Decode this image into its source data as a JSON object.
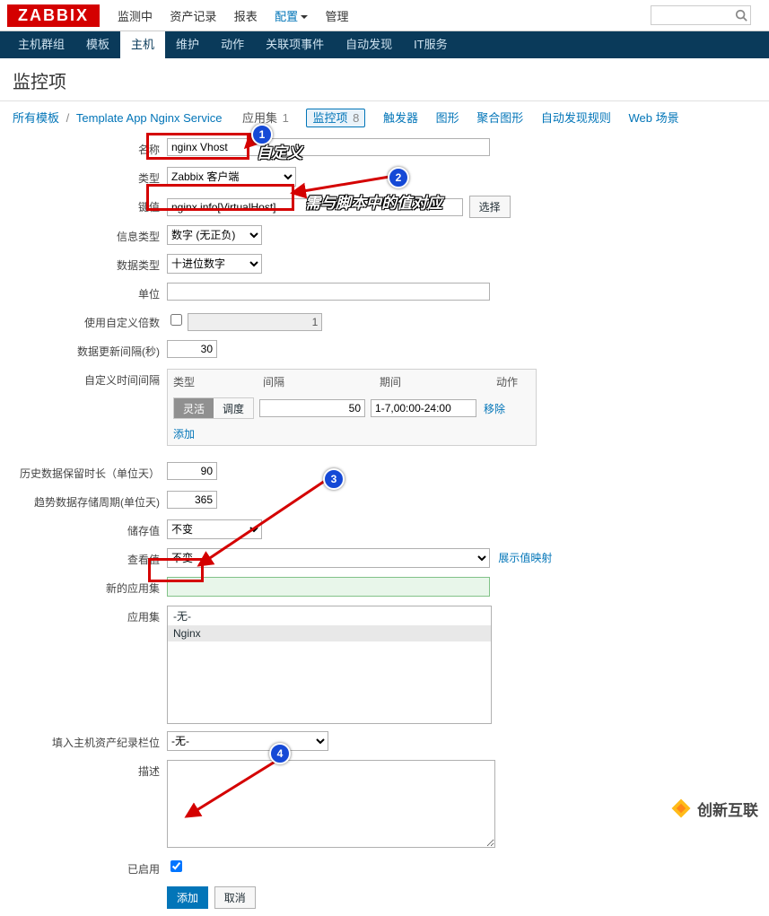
{
  "brand": "ZABBIX",
  "topnav": {
    "items": [
      "监测中",
      "资产记录",
      "报表",
      "配置",
      "管理"
    ],
    "active_idx": 3
  },
  "subnav": {
    "items": [
      "主机群组",
      "模板",
      "主机",
      "维护",
      "动作",
      "关联项事件",
      "自动发现",
      "IT服务"
    ],
    "active_idx": 2
  },
  "page_title": "监控项",
  "crumbs": {
    "root": "所有模板",
    "template": "Template App Nginx Service",
    "tabs": [
      {
        "label": "应用集",
        "count": "1"
      },
      {
        "label": "监控项",
        "count": "8",
        "current": true
      },
      {
        "label": "触发器",
        "count": ""
      },
      {
        "label": "图形",
        "count": ""
      },
      {
        "label": "聚合图形",
        "count": ""
      },
      {
        "label": "自动发现规则",
        "count": ""
      },
      {
        "label": "Web 场景",
        "count": ""
      }
    ]
  },
  "form": {
    "labels": {
      "name": "名称",
      "type": "类型",
      "key": "键值",
      "info_type": "信息类型",
      "data_type": "数据类型",
      "unit": "单位",
      "use_mult": "使用自定义倍数",
      "update": "数据更新间隔(秒)",
      "custom_int": "自定义时间间隔",
      "history": "历史数据保留时长（单位天）",
      "trend": "趋势数据存储周期(单位天)",
      "store": "储存值",
      "viewval": "查看值",
      "newapp": "新的应用集",
      "apps": "应用集",
      "inventory": "填入主机资产纪录栏位",
      "desc": "描述",
      "enabled": "已启用"
    },
    "name": "nginx Vhost",
    "type": "Zabbix 客户端",
    "key": "nginx.info[VirtualHost]",
    "select_btn": "选择",
    "info_type": "数字 (无正负)",
    "data_type": "十进位数字",
    "unit": "",
    "use_mult": false,
    "mult_val": "1",
    "update": "30",
    "interval": {
      "head": {
        "type": "类型",
        "interval": "间隔",
        "period": "期间",
        "action": "动作"
      },
      "flex": "灵活",
      "sched": "调度",
      "interval_val": "50",
      "period_val": "1-7,00:00-24:00",
      "remove": "移除",
      "add": "添加"
    },
    "history": "90",
    "trend": "365",
    "store": "不变",
    "viewval": "不变",
    "show_map": "展示值映射",
    "app_options": [
      "-无-",
      "Nginx"
    ],
    "app_selected": "Nginx",
    "inventory_val": "-无-",
    "enabled": true,
    "submit": "添加",
    "cancel": "取消"
  },
  "callouts": {
    "c1": "自定义",
    "c2": "需与脚本中的值对应"
  },
  "watermark": "创新互联"
}
